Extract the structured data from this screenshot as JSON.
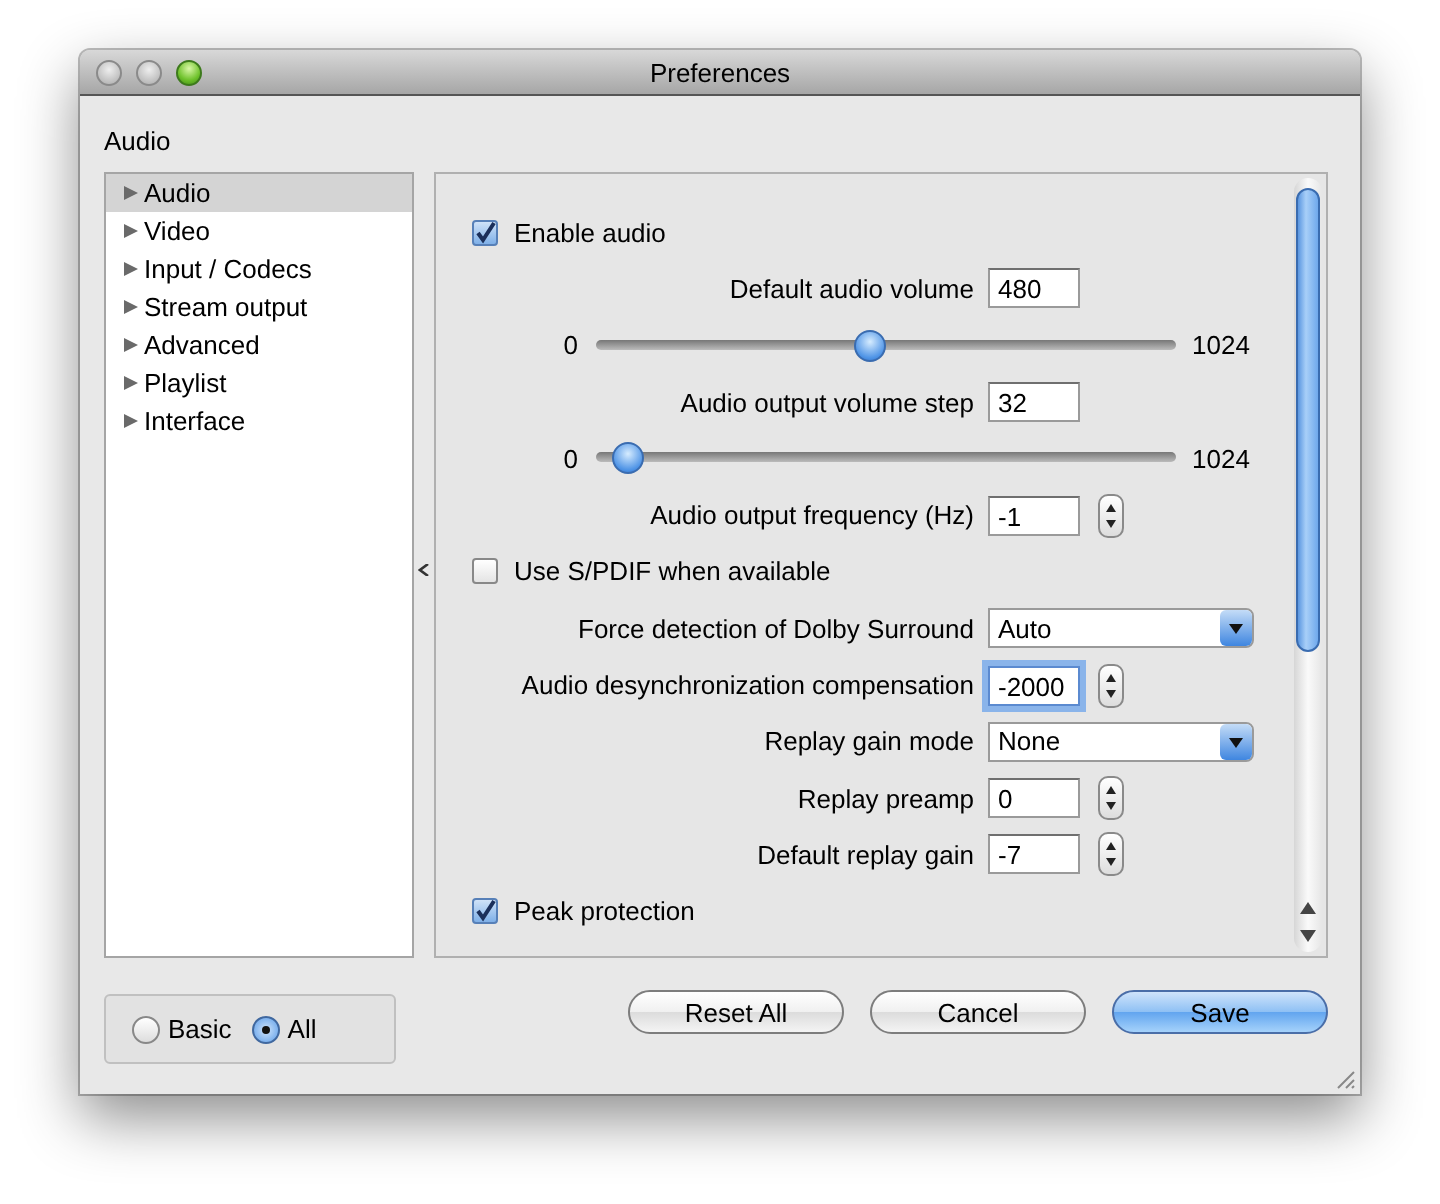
{
  "window": {
    "title": "Preferences"
  },
  "section_title": "Audio",
  "sidebar": {
    "items": [
      {
        "label": "Audio",
        "selected": true
      },
      {
        "label": "Video",
        "selected": false
      },
      {
        "label": "Input / Codecs",
        "selected": false
      },
      {
        "label": "Stream output",
        "selected": false
      },
      {
        "label": "Advanced",
        "selected": false
      },
      {
        "label": "Playlist",
        "selected": false
      },
      {
        "label": "Interface",
        "selected": false
      }
    ]
  },
  "settings": [
    {
      "kind": "checkbox",
      "label": "Enable audio",
      "checked": true
    },
    {
      "kind": "field",
      "label": "Default audio volume",
      "value": "480"
    },
    {
      "kind": "slider",
      "min": "0",
      "max": "1024",
      "level": 0.47
    },
    {
      "kind": "field",
      "label": "Audio output volume step",
      "value": "32"
    },
    {
      "kind": "slider",
      "min": "0",
      "max": "1024",
      "level": 0.03
    },
    {
      "kind": "spin",
      "label": "Audio output frequency (Hz)",
      "value": "-1",
      "focused": false
    },
    {
      "kind": "checkbox",
      "label": "Use S/PDIF when available",
      "checked": false
    },
    {
      "kind": "select",
      "label": "Force detection of Dolby Surround",
      "value": "Auto"
    },
    {
      "kind": "spin",
      "label": "Audio desynchronization compensation",
      "value": "-2000",
      "focused": true
    },
    {
      "kind": "select",
      "label": "Replay gain mode",
      "value": "None"
    },
    {
      "kind": "spin",
      "label": "Replay preamp",
      "value": "0",
      "focused": false
    },
    {
      "kind": "spin",
      "label": "Default replay gain",
      "value": "-7",
      "focused": false
    },
    {
      "kind": "checkbox",
      "label": "Peak protection",
      "checked": true
    }
  ],
  "mode": {
    "options": [
      {
        "label": "Basic",
        "selected": false
      },
      {
        "label": "All",
        "selected": true
      }
    ]
  },
  "buttons": [
    {
      "label": "Reset All",
      "primary": false
    },
    {
      "label": "Cancel",
      "primary": false
    },
    {
      "label": "Save",
      "primary": true
    }
  ]
}
